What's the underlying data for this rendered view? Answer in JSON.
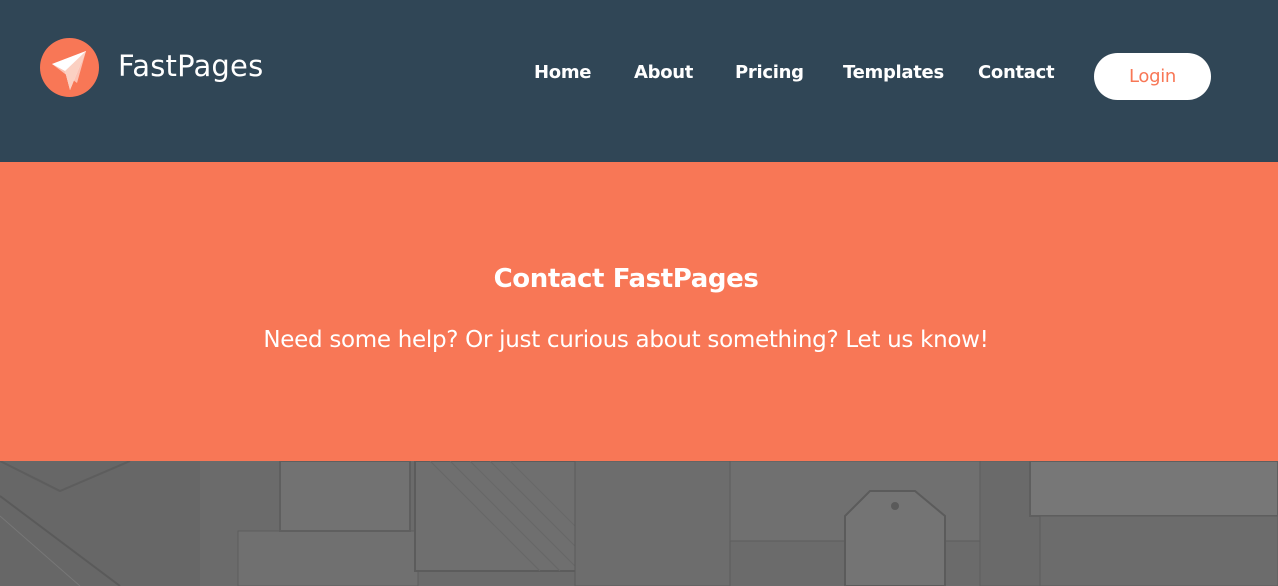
{
  "brand": {
    "name_part1": "Fast",
    "name_part2": "Pages",
    "accent_color": "#f87756",
    "header_color": "#304656"
  },
  "nav": {
    "items": [
      {
        "label": "Home"
      },
      {
        "label": "About"
      },
      {
        "label": "Pricing"
      },
      {
        "label": "Templates"
      },
      {
        "label": "Contact"
      }
    ],
    "login_label": "Login"
  },
  "hero": {
    "title": "Contact FastPages",
    "subtitle": "Need some help? Or just curious about something? Let us know!"
  },
  "icons": {
    "logo": "paper-plane-logo-icon"
  }
}
